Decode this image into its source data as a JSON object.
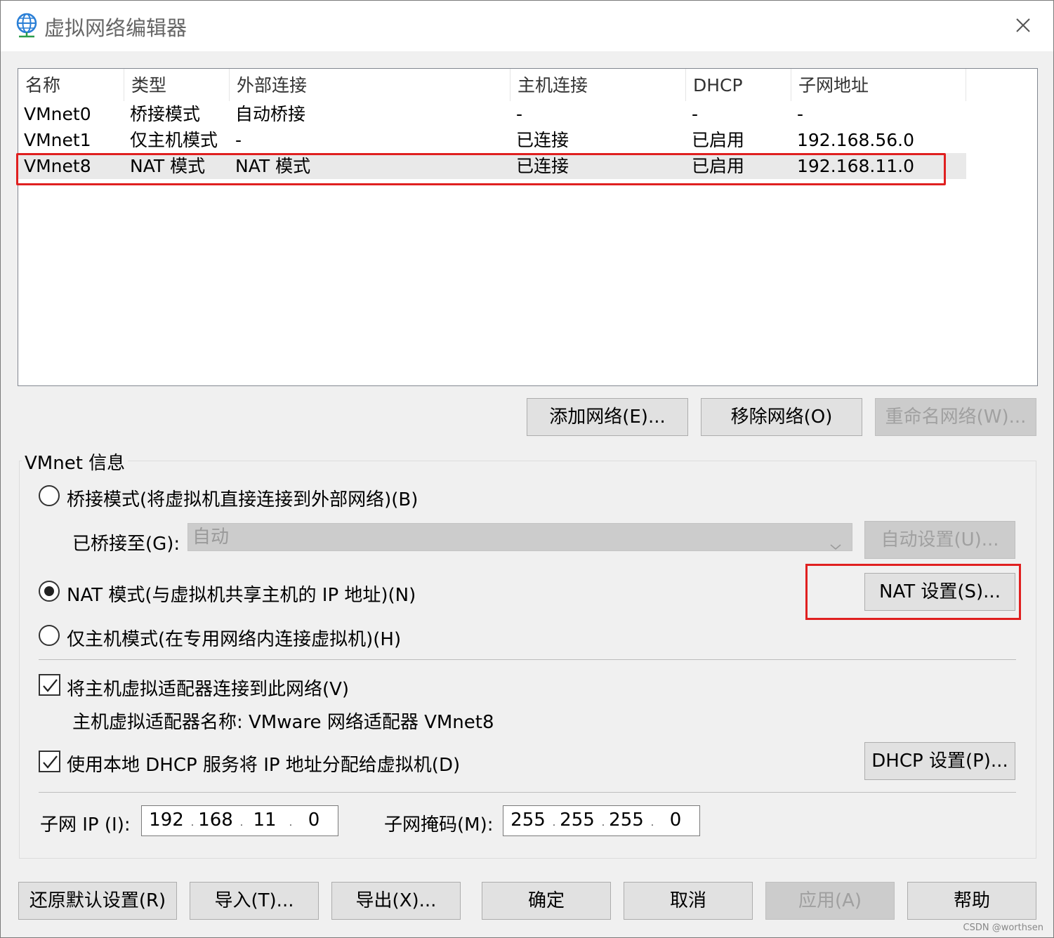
{
  "window": {
    "title": "虚拟网络编辑器",
    "icon": "globe-icon",
    "close_icon": "close-icon"
  },
  "network_list": {
    "columns": [
      "名称",
      "类型",
      "外部连接",
      "主机连接",
      "DHCP",
      "子网地址"
    ],
    "rows": [
      {
        "name": "VMnet0",
        "type": "桥接模式",
        "external": "自动桥接",
        "host": "-",
        "dhcp": "-",
        "subnet": "-"
      },
      {
        "name": "VMnet1",
        "type": "仅主机模式",
        "external": "-",
        "host": "已连接",
        "dhcp": "已启用",
        "subnet": "192.168.56.0"
      },
      {
        "name": "VMnet8",
        "type": "NAT 模式",
        "external": "NAT 模式",
        "host": "已连接",
        "dhcp": "已启用",
        "subnet": "192.168.11.0"
      }
    ],
    "selected_index": 2
  },
  "list_buttons": {
    "add": "添加网络(E)...",
    "remove": "移除网络(O)",
    "rename": "重命名网络(W)..."
  },
  "vmnet_info": {
    "group_label": "VMnet 信息",
    "bridge_label": "桥接模式(将虚拟机直接连接到外部网络)(B)",
    "bridged_to_label": "已桥接至(G):",
    "bridged_to_value": "自动",
    "auto_settings": "自动设置(U)...",
    "nat_label": "NAT 模式(与虚拟机共享主机的 IP 地址)(N)",
    "nat_settings": "NAT 设置(S)...",
    "hostonly_label": "仅主机模式(在专用网络内连接虚拟机)(H)",
    "selected_mode": "nat",
    "connect_adapter_label": "将主机虚拟适配器连接到此网络(V)",
    "connect_adapter_checked": true,
    "adapter_name_label": "主机虚拟适配器名称: VMware 网络适配器 VMnet8",
    "dhcp_label": "使用本地 DHCP 服务将 IP 地址分配给虚拟机(D)",
    "dhcp_checked": true,
    "dhcp_settings": "DHCP 设置(P)...",
    "subnet_ip_label": "子网 IP (I):",
    "subnet_ip": [
      "192",
      "168",
      "11",
      "0"
    ],
    "subnet_mask_label": "子网掩码(M):",
    "subnet_mask": [
      "255",
      "255",
      "255",
      "0"
    ]
  },
  "footer_buttons": {
    "restore": "还原默认设置(R)",
    "import": "导入(T)...",
    "export": "导出(X)...",
    "ok": "确定",
    "cancel": "取消",
    "apply": "应用(A)",
    "help": "帮助"
  },
  "watermark": "CSDN @worthsen",
  "colors": {
    "highlight": "#e02020",
    "dialog_bg": "#f0f0f0",
    "button_bg": "#e1e1e1"
  }
}
